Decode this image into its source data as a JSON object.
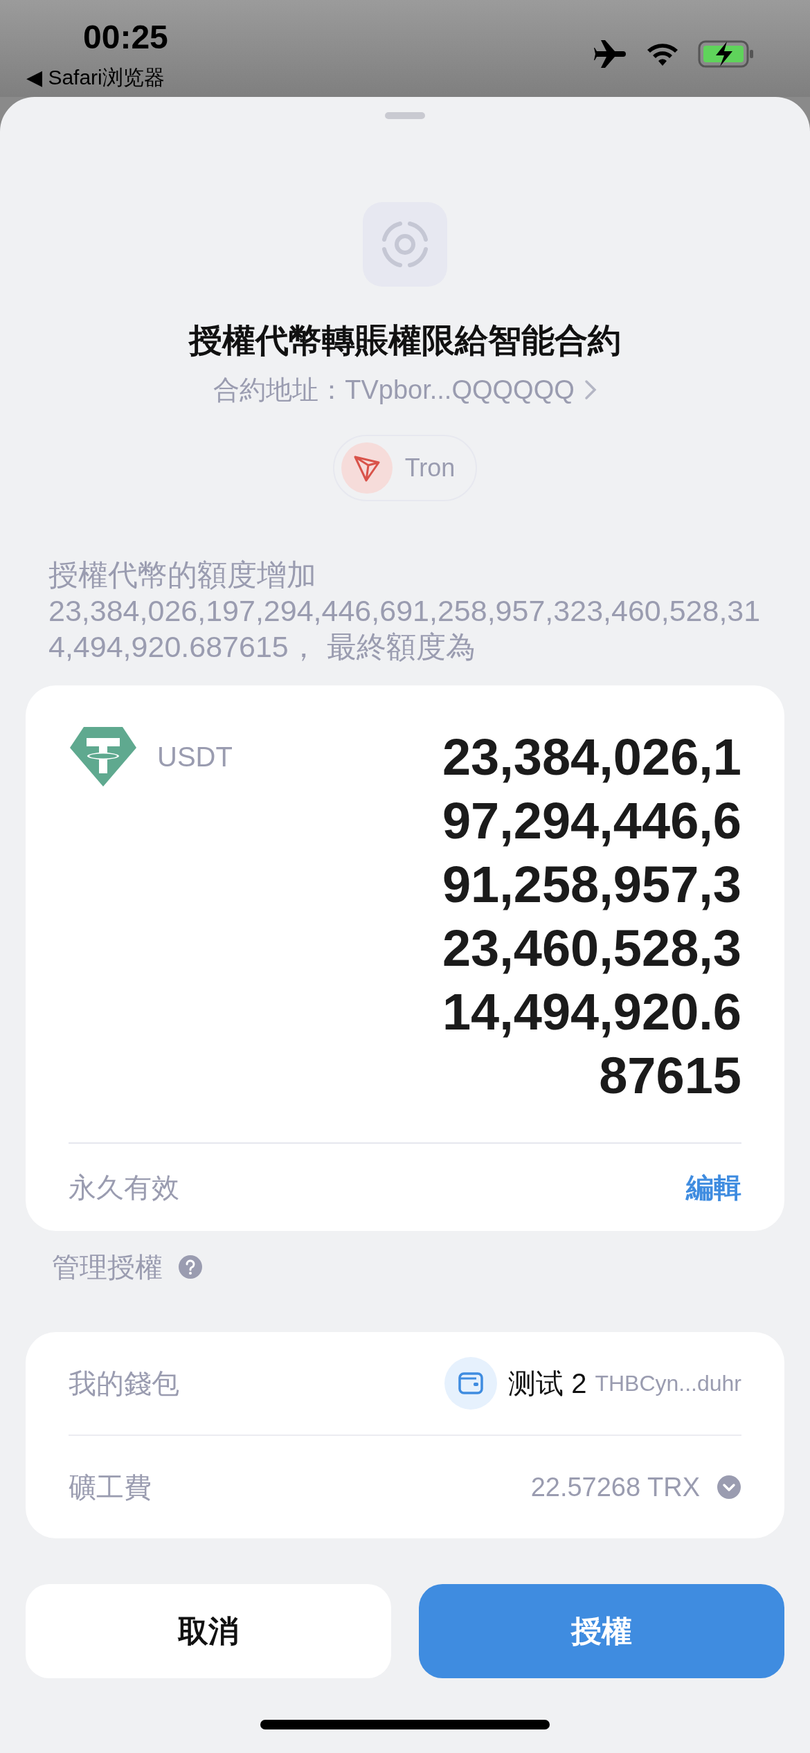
{
  "status_bar": {
    "time": "00:25",
    "back_link": "◀ Safari浏览器"
  },
  "request": {
    "title": "授權代幣轉賬權限給智能合約",
    "contract_address": "合約地址：TVpbor...QQQQQQ",
    "network": "Tron"
  },
  "description": "授權代幣的額度增加 23,384,026,197,294,446,691,258,957,323,460,528,314,494,920.687615， 最終額度為",
  "allowance": {
    "token": "USDT",
    "amount": "23,384,026,197,294,446,691,258,957,323,460,528,314,494,920.687615",
    "validity": "永久有效",
    "edit": "編輯"
  },
  "manage": {
    "title": "管理授權",
    "rows": [
      {
        "kind": "wallet",
        "label": "我的錢包",
        "name": "测试 2",
        "address": "THBCyn...duhr"
      },
      {
        "kind": "fee",
        "label": "礦工費",
        "value": "22.57268 TRX"
      }
    ]
  },
  "buttons": [
    {
      "kind": "secondary",
      "label": "取消"
    },
    {
      "kind": "primary",
      "label": "授權"
    }
  ]
}
